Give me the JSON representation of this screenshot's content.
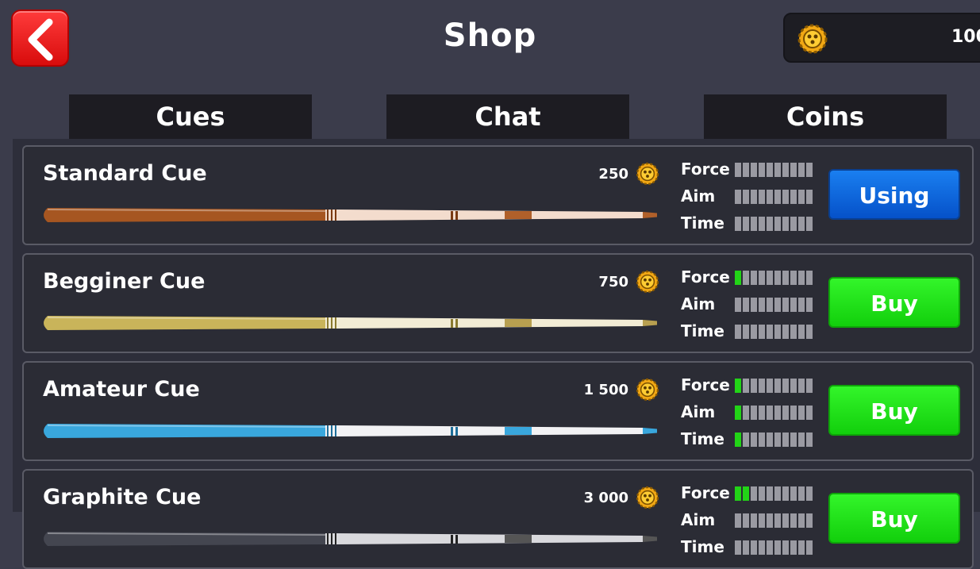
{
  "header": {
    "back_icon": "chevron-left-icon",
    "title": "Shop",
    "balance": "100",
    "coin_icon": "coin-icon"
  },
  "tabs": [
    {
      "label": "Cues"
    },
    {
      "label": "Chat"
    },
    {
      "label": "Coins"
    }
  ],
  "stat_labels": {
    "force": "Force",
    "aim": "Aim",
    "time": "Time"
  },
  "cues": [
    {
      "name": "Standard Cue",
      "price": "250",
      "force": 0,
      "aim": 0,
      "time": 0,
      "action": "Using",
      "state": "using",
      "style": "wood"
    },
    {
      "name": "Begginer Cue",
      "price": "750",
      "force": 1,
      "aim": 0,
      "time": 0,
      "action": "Buy",
      "state": "buy",
      "style": "gold"
    },
    {
      "name": "Amateur Cue",
      "price": "1 500",
      "force": 1,
      "aim": 1,
      "time": 1,
      "action": "Buy",
      "state": "buy",
      "style": "blue"
    },
    {
      "name": "Graphite Cue",
      "price": "3 000",
      "force": 2,
      "aim": 0,
      "time": 0,
      "action": "Buy",
      "state": "buy",
      "style": "graphite"
    }
  ],
  "stat_max": 10,
  "colors": {
    "background": "#3b3c4b",
    "back_button": "#ff2020",
    "using_button": "#0b63db",
    "buy_button": "#1ee516",
    "stat_on": "#22d417",
    "stat_off": "#9a9aa2"
  }
}
